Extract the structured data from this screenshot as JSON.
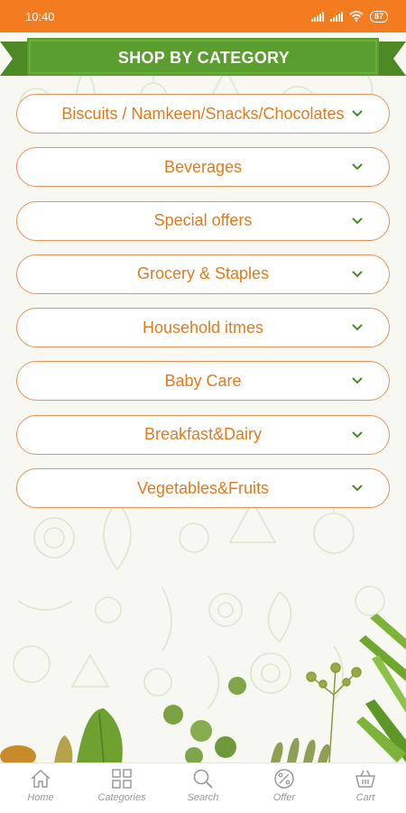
{
  "status_bar": {
    "time": "10:40",
    "battery": "87"
  },
  "header": {
    "title": "SHOP BY CATEGORY"
  },
  "categories": [
    {
      "label": "Biscuits / Namkeen/Snacks/Chocolates"
    },
    {
      "label": "Beverages"
    },
    {
      "label": "Special offers"
    },
    {
      "label": "Grocery & Staples"
    },
    {
      "label": "Household itmes"
    },
    {
      "label": "Baby Care"
    },
    {
      "label": "Breakfast&Dairy"
    },
    {
      "label": "Vegetables&Fruits"
    }
  ],
  "bottom_nav": [
    {
      "label": "Home",
      "icon": "home-icon"
    },
    {
      "label": "Categories",
      "icon": "grid-icon"
    },
    {
      "label": "Search",
      "icon": "search-icon"
    },
    {
      "label": "Offer",
      "icon": "percent-icon"
    },
    {
      "label": "Cart",
      "icon": "cart-icon"
    }
  ],
  "colors": {
    "status_bar": "#f47c20",
    "banner_green": "#5a9e2f",
    "category_text": "#e07b1f",
    "category_border": "#e8925a",
    "chevron": "#4a8a2a"
  }
}
